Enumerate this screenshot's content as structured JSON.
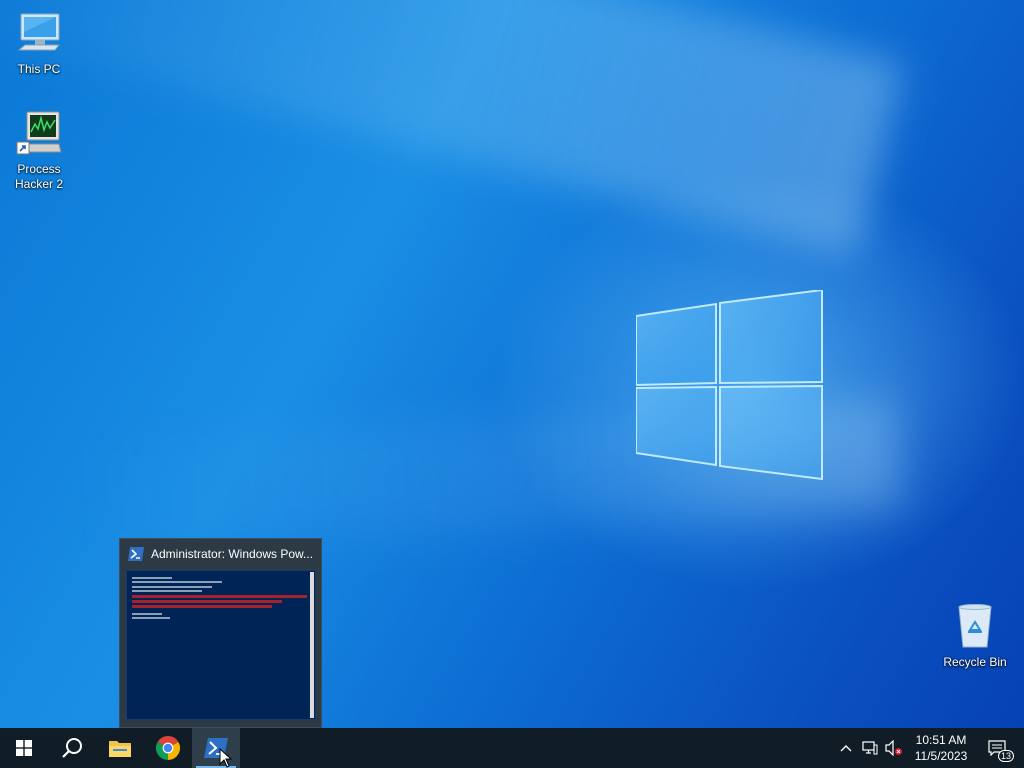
{
  "desktop": {
    "icons": [
      {
        "label": "This PC",
        "icon": "computer-icon"
      },
      {
        "label": "Process\nHacker 2",
        "icon": "process-hacker-icon"
      },
      {
        "label": "Recycle Bin",
        "icon": "recycle-bin-icon"
      }
    ]
  },
  "thumbnail": {
    "title": "Administrator: Windows Pow..."
  },
  "taskbar": {
    "buttons": [
      {
        "name": "start",
        "icon": "windows-logo-icon"
      },
      {
        "name": "search",
        "icon": "search-icon"
      },
      {
        "name": "file-explorer",
        "icon": "folder-icon"
      },
      {
        "name": "chrome",
        "icon": "chrome-icon"
      },
      {
        "name": "powershell",
        "icon": "powershell-icon",
        "active": true
      }
    ],
    "tray": {
      "time": "10:51 AM",
      "date": "11/5/2023",
      "notification_count": "13"
    }
  },
  "colors": {
    "taskbar": "#101d26",
    "active_underline": "#76b9ed",
    "powershell_bg": "#012456"
  }
}
